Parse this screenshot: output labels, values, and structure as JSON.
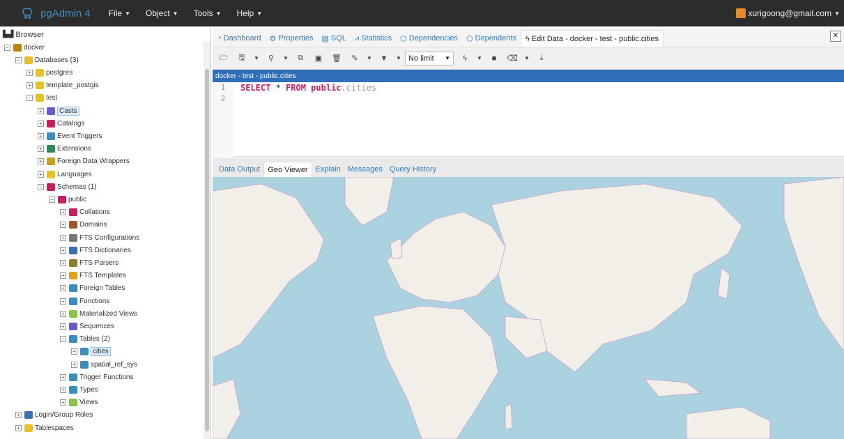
{
  "navbar": {
    "brand": "pgAdmin 4",
    "menus": [
      "File",
      "Object",
      "Tools",
      "Help"
    ],
    "user": "xurigoong@gmail.com"
  },
  "browser": {
    "title": "Browser",
    "tree": [
      {
        "label": "docker",
        "indent": 0,
        "open": true
      },
      {
        "label": "Databases (3)",
        "indent": 1,
        "open": true
      },
      {
        "label": "postgres",
        "indent": 2
      },
      {
        "label": "template_postgis",
        "indent": 2
      },
      {
        "label": "test",
        "indent": 2,
        "open": true
      },
      {
        "label": "Casts",
        "indent": 3,
        "selected": true
      },
      {
        "label": "Catalogs",
        "indent": 3
      },
      {
        "label": "Event Triggers",
        "indent": 3
      },
      {
        "label": "Extensions",
        "indent": 3
      },
      {
        "label": "Foreign Data Wrappers",
        "indent": 3
      },
      {
        "label": "Languages",
        "indent": 3
      },
      {
        "label": "Schemas (1)",
        "indent": 3,
        "open": true
      },
      {
        "label": "public",
        "indent": 4,
        "open": true
      },
      {
        "label": "Collations",
        "indent": 5
      },
      {
        "label": "Domains",
        "indent": 5
      },
      {
        "label": "FTS Configurations",
        "indent": 5
      },
      {
        "label": "FTS Dictionaries",
        "indent": 5
      },
      {
        "label": "FTS Parsers",
        "indent": 5
      },
      {
        "label": "FTS Templates",
        "indent": 5
      },
      {
        "label": "Foreign Tables",
        "indent": 5
      },
      {
        "label": "Functions",
        "indent": 5
      },
      {
        "label": "Materialized Views",
        "indent": 5
      },
      {
        "label": "Sequences",
        "indent": 5
      },
      {
        "label": "Tables (2)",
        "indent": 5,
        "open": true
      },
      {
        "label": "cities",
        "indent": 6,
        "selected": true
      },
      {
        "label": "spatial_ref_sys",
        "indent": 6
      },
      {
        "label": "Trigger Functions",
        "indent": 5
      },
      {
        "label": "Types",
        "indent": 5
      },
      {
        "label": "Views",
        "indent": 5
      },
      {
        "label": "Login/Group Roles",
        "indent": 1
      },
      {
        "label": "Tablespaces",
        "indent": 1
      }
    ]
  },
  "tabs": [
    {
      "label": "Dashboard",
      "icon": "dashboard-icon"
    },
    {
      "label": "Properties",
      "icon": "properties-icon"
    },
    {
      "label": "SQL",
      "icon": "sql-icon"
    },
    {
      "label": "Statistics",
      "icon": "statistics-icon"
    },
    {
      "label": "Dependencies",
      "icon": "dependencies-icon"
    },
    {
      "label": "Dependents",
      "icon": "dependents-icon"
    },
    {
      "label": "Edit Data - docker - test - public.cities",
      "icon": "bolt-icon",
      "active": true
    }
  ],
  "toolbar": {
    "limit": "No limit"
  },
  "query": {
    "title": "docker - test - public.cities",
    "line_numbers": [
      "1",
      "2"
    ],
    "kw1": "SELECT",
    "star": " * ",
    "kw2": "FROM",
    "schema": " public",
    "table": ".cities"
  },
  "results": {
    "tabs": [
      "Data Output",
      "Geo Viewer",
      "Explain",
      "Messages",
      "Query History"
    ],
    "active": "Geo Viewer"
  },
  "colors": {
    "navbar": "#2c2c2c",
    "brand": "#3c8dbc",
    "query_bar": "#2f6fb9",
    "water": "#aad3df",
    "land": "#f2efe9",
    "border": "#c99fcf"
  }
}
